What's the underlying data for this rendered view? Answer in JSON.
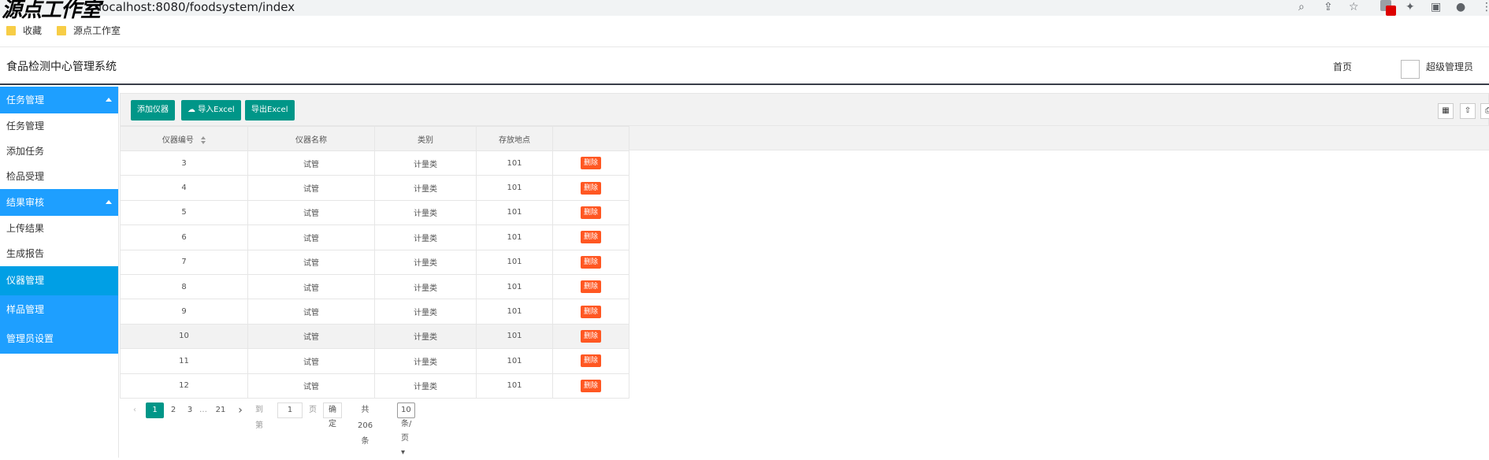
{
  "browser": {
    "url": "localhost:8080/foodsystem/index",
    "watermark": "源点工作室",
    "bookmarks": [
      {
        "label": "收藏"
      },
      {
        "label": "源点工作室"
      }
    ]
  },
  "header": {
    "title": "食品检测中心管理系统",
    "home": "首页",
    "admin": "超级管理员"
  },
  "sidebar": {
    "groups": [
      {
        "label": "任务管理",
        "items": [
          "任务管理",
          "添加任务",
          "检品受理"
        ]
      },
      {
        "label": "结果审核",
        "items": [
          "上传结果",
          "生成报告"
        ]
      }
    ],
    "active": "仪器管理",
    "others": [
      "样品管理",
      "管理员设置"
    ]
  },
  "toolbar": {
    "add": "添加仪器",
    "import": "导入Excel",
    "export": "导出Excel"
  },
  "table": {
    "columns": [
      "仪器编号",
      "仪器名称",
      "类别",
      "存放地点",
      ""
    ],
    "delete_label": "删除",
    "rows": [
      {
        "id": "3",
        "name": "试管",
        "category": "计量类",
        "location": "101"
      },
      {
        "id": "4",
        "name": "试管",
        "category": "计量类",
        "location": "101"
      },
      {
        "id": "5",
        "name": "试管",
        "category": "计量类",
        "location": "101"
      },
      {
        "id": "6",
        "name": "试管",
        "category": "计量类",
        "location": "101"
      },
      {
        "id": "7",
        "name": "试管",
        "category": "计量类",
        "location": "101"
      },
      {
        "id": "8",
        "name": "试管",
        "category": "计量类",
        "location": "101"
      },
      {
        "id": "9",
        "name": "试管",
        "category": "计量类",
        "location": "101"
      },
      {
        "id": "10",
        "name": "试管",
        "category": "计量类",
        "location": "101"
      },
      {
        "id": "11",
        "name": "试管",
        "category": "计量类",
        "location": "101"
      },
      {
        "id": "12",
        "name": "试管",
        "category": "计量类",
        "location": "101"
      }
    ]
  },
  "pager": {
    "current": "1",
    "pages": [
      "2",
      "3"
    ],
    "ellipsis": "…",
    "last": "21",
    "goto_label": "到第",
    "goto_value": "1",
    "page_unit": "页",
    "confirm": "确定",
    "total": "共 206 条",
    "per_page": "10 条/页"
  }
}
